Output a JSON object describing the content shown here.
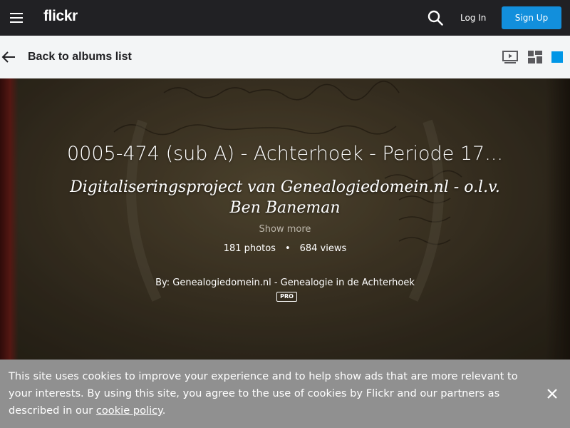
{
  "header": {
    "logo": "flickr",
    "login_label": "Log In",
    "signup_label": "Sign Up",
    "icons": [
      "menu-icon",
      "search-icon"
    ]
  },
  "subnav": {
    "back_label": "Back to albums list",
    "icons": [
      "back-arrow-icon",
      "slideshow-icon",
      "grid-view-icon",
      "single-view-icon"
    ],
    "active_color": "#0096e6"
  },
  "album": {
    "title": "0005-474 (sub A) - Achterhoek - Periode 17...",
    "description": "Digitaliseringsproject van Genealogiedomein.nl - o.l.v. Ben Baneman",
    "show_more": "Show more",
    "photos": "181 photos",
    "separator": "•",
    "views": "684 views",
    "byline": "By: Genealogiedomein.nl - Genealogie in de Achterhoek",
    "badge": "PRO"
  },
  "cookie": {
    "text": "This site uses cookies to improve your experience and to help show ads that are more relevant to your interests. By using this site, you agree to the use of cookies by Flickr and our partners as described in our ",
    "link": "cookie policy",
    "end": "."
  },
  "colors": {
    "nav_bg": "#212124",
    "subnav_bg": "#f3f5f6",
    "accent": "#128fdc",
    "cookie_bg": "#909090"
  }
}
